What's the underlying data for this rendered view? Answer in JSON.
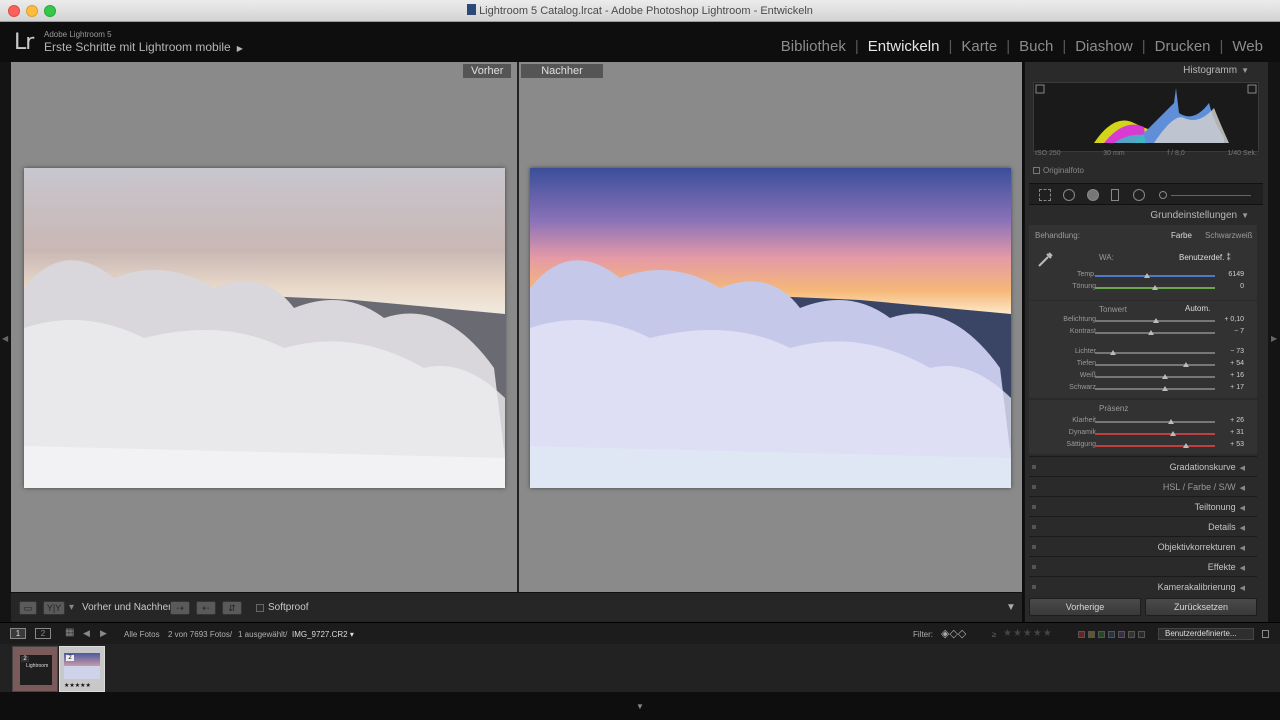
{
  "window": {
    "title": "Lightroom 5 Catalog.lrcat - Adobe Photoshop Lightroom - Entwickeln"
  },
  "identity": {
    "small": "Adobe Lightroom 5",
    "main": "Erste Schritte mit Lightroom mobile",
    "logo": "Lr"
  },
  "modules": [
    "Bibliothek",
    "Entwickeln",
    "Karte",
    "Buch",
    "Diashow",
    "Drucken",
    "Web"
  ],
  "active_module": "Entwickeln",
  "viewer": {
    "before_label": "Vorher",
    "after_label": "Nachher"
  },
  "toolbar": {
    "yy_label": "Y|Y",
    "mode_label": "Vorher und Nachher:",
    "softproof_label": "Softproof"
  },
  "panel": {
    "histogram_title": "Histogramm",
    "iso": "ISO 250",
    "focal": "30 mm",
    "aperture": "f / 8,0",
    "shutter": "1/40 Sek.",
    "original_label": "Originalfoto",
    "basic_title": "Grundeinstellungen",
    "treatment_label": "Behandlung:",
    "treatment_color": "Farbe",
    "treatment_bw": "Schwarzweiß",
    "wb_label": "WA:",
    "wb_value": "Benutzerdef.",
    "tone_label": "Tonwert",
    "auto_label": "Autom.",
    "presence_label": "Präsenz",
    "sliders": [
      {
        "label": "Temp.",
        "value": "6149",
        "pos": 0.43,
        "color": "#4d78c8"
      },
      {
        "label": "Tönung",
        "value": "0",
        "pos": 0.5,
        "color": "#6aa84f"
      },
      {
        "label": "Belichtung",
        "value": "+ 0,10",
        "pos": 0.51,
        "color": "#777"
      },
      {
        "label": "Kontrast",
        "value": "− 7",
        "pos": 0.47,
        "color": "#777"
      },
      {
        "label": "Lichter",
        "value": "− 73",
        "pos": 0.15,
        "color": "#777"
      },
      {
        "label": "Tiefen",
        "value": "+ 54",
        "pos": 0.76,
        "color": "#777"
      },
      {
        "label": "Weiß",
        "value": "+ 16",
        "pos": 0.58,
        "color": "#777"
      },
      {
        "label": "Schwarz",
        "value": "+ 17",
        "pos": 0.58,
        "color": "#777"
      },
      {
        "label": "Klarheit",
        "value": "+ 26",
        "pos": 0.63,
        "color": "#777"
      },
      {
        "label": "Dynamik",
        "value": "+ 31",
        "pos": 0.65,
        "color": "#c04040"
      },
      {
        "label": "Sättigung",
        "value": "+ 53",
        "pos": 0.76,
        "color": "#c04040"
      }
    ],
    "collapsed": [
      "Gradationskurve",
      "HSL / Farbe / S/W",
      "Teiltonung",
      "Details",
      "Objektivkorrekturen",
      "Effekte",
      "Kamerakalibrierung"
    ],
    "prev_button": "Vorherige",
    "reset_button": "Zurücksetzen"
  },
  "filmstrip_bar": {
    "page1": "1",
    "page2": "2",
    "source": "Alle Fotos",
    "count": "2 von 7693 Fotos/",
    "selected": "1 ausgewählt/",
    "filename": "IMG_9727.CR2",
    "filter_label": "Filter:",
    "custom": "Benutzerdefinierte..."
  },
  "filmstrip": {
    "thumb1_label": "Lightroom",
    "thumb2_badge": "2",
    "thumb1_badge": "2",
    "rating": "★★★★★"
  }
}
